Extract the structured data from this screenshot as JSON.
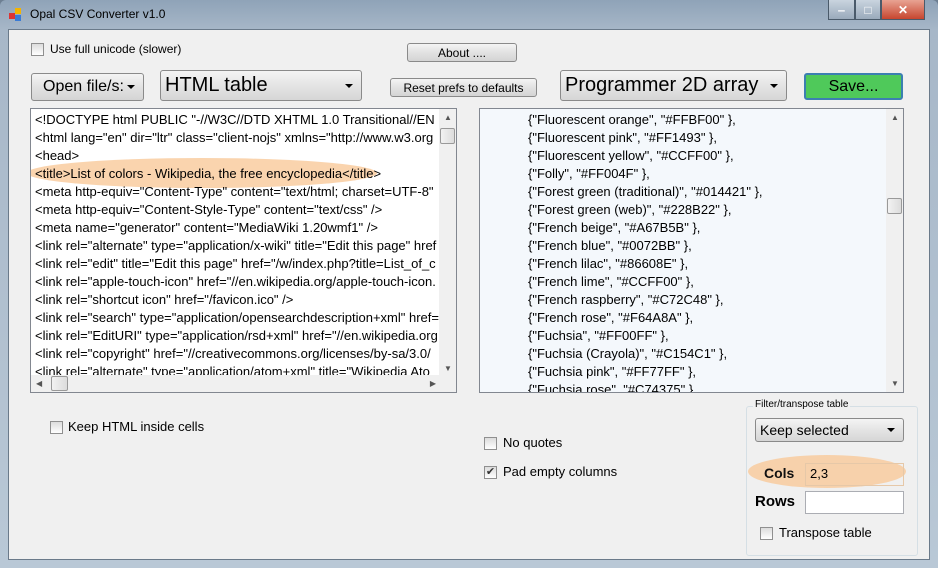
{
  "window": {
    "title": "Opal CSV Converter v1.0",
    "minimize": "‒",
    "maximize": "□",
    "close": "✕"
  },
  "options": {
    "full_unicode": {
      "label": "Use full unicode (slower)",
      "checked": false
    }
  },
  "toolbar": {
    "about": "About ....",
    "open": "Open file/s:",
    "input_format": "HTML table",
    "reset": "Reset prefs to defaults",
    "output_format": "Programmer 2D array",
    "save": "Save..."
  },
  "colors": {
    "save": "#4fc95a",
    "highlight": "#f9c99a"
  },
  "input_text": [
    "<!DOCTYPE html PUBLIC \"-//W3C//DTD XHTML 1.0 Transitional//EN",
    "<html lang=\"en\" dir=\"ltr\" class=\"client-nojs\" xmlns=\"http://www.w3.org",
    "<head>",
    "<title>List of colors - Wikipedia, the free encyclopedia</title>",
    "<meta http-equiv=\"Content-Type\" content=\"text/html; charset=UTF-8\"",
    "<meta http-equiv=\"Content-Style-Type\" content=\"text/css\" />",
    "<meta name=\"generator\" content=\"MediaWiki 1.20wmf1\" />",
    "<link rel=\"alternate\" type=\"application/x-wiki\" title=\"Edit this page\" href",
    "<link rel=\"edit\" title=\"Edit this page\" href=\"/w/index.php?title=List_of_c",
    "<link rel=\"apple-touch-icon\" href=\"//en.wikipedia.org/apple-touch-icon.",
    "<link rel=\"shortcut icon\" href=\"/favicon.ico\" />",
    "<link rel=\"search\" type=\"application/opensearchdescription+xml\" href=",
    "<link rel=\"EditURI\" type=\"application/rsd+xml\" href=\"//en.wikipedia.org",
    "<link rel=\"copyright\" href=\"//creativecommons.org/licenses/by-sa/3.0/",
    "<link rel=\"alternate\" type=\"application/atom+xml\" title=\"Wikipedia Ato"
  ],
  "output_text": [
    "{\"Fluorescent orange\", \"#FFBF00\" },",
    "{\"Fluorescent pink\", \"#FF1493\" },",
    "{\"Fluorescent yellow\", \"#CCFF00\" },",
    "{\"Folly\", \"#FF004F\" },",
    "{\"Forest green (traditional)\", \"#014421\" },",
    "{\"Forest green (web)\", \"#228B22\" },",
    "{\"French beige\", \"#A67B5B\" },",
    "{\"French blue\", \"#0072BB\" },",
    "{\"French lilac\", \"#86608E\" },",
    "{\"French lime\", \"#CCFF00\" },",
    "{\"French raspberry\", \"#C72C48\" },",
    "{\"French rose\", \"#F64A8A\" },",
    "{\"Fuchsia\", \"#FF00FF\" },",
    "{\"Fuchsia (Crayola)\", \"#C154C1\" },",
    "{\"Fuchsia pink\", \"#FF77FF\" },",
    "{\"Fuchsia rose\", \"#C74375\" },"
  ],
  "settings": {
    "keep_html": {
      "label": "Keep HTML inside cells",
      "checked": false
    },
    "no_quotes": {
      "label": "No quotes",
      "checked": false
    },
    "pad_empty": {
      "label": "Pad empty columns",
      "checked": true
    }
  },
  "filter": {
    "group_label": "Filter/transpose table",
    "mode": "Keep selected",
    "cols_label": "Cols",
    "cols_value": "2,3",
    "rows_label": "Rows",
    "rows_value": "",
    "transpose": {
      "label": "Transpose table",
      "checked": false
    }
  }
}
